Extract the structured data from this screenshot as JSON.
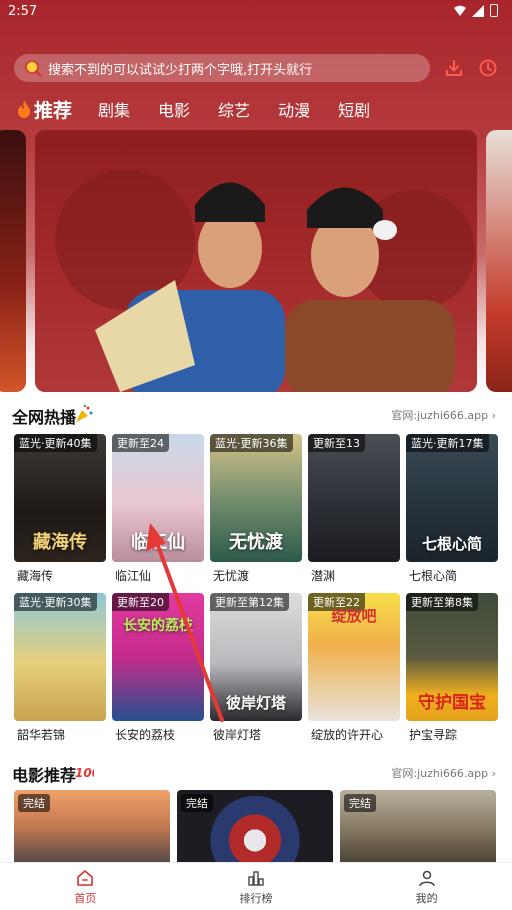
{
  "status": {
    "time": "2:57"
  },
  "search": {
    "placeholder": "搜索不到的可以试试少打两个字哦,打开头就行"
  },
  "tabs": [
    {
      "label": "推荐"
    },
    {
      "label": "剧集"
    },
    {
      "label": "电影"
    },
    {
      "label": "综艺"
    },
    {
      "label": "动漫"
    },
    {
      "label": "短剧"
    }
  ],
  "hot": {
    "title": "全网热播",
    "link": "官网:juzhi666.app",
    "items": [
      {
        "badge": "蓝光·更新40集",
        "title": "藏海传",
        "poster_title": "藏海传"
      },
      {
        "badge": "更新至24",
        "title": "临江仙",
        "poster_title": "临江仙"
      },
      {
        "badge": "蓝光·更新36集",
        "title": "无忧渡",
        "poster_title": "无忧渡"
      },
      {
        "badge": "更新至13",
        "title": "潜渊",
        "poster_title": ""
      },
      {
        "badge": "蓝光·更新17集",
        "title": "七根心简",
        "poster_title": "七根心简"
      },
      {
        "badge": "蓝光·更新30集",
        "title": "韶华若锦",
        "poster_title": ""
      },
      {
        "badge": "更新至20",
        "title": "长安的荔枝",
        "poster_title": "长安的荔枝"
      },
      {
        "badge": "更新至第12集",
        "title": "彼岸灯塔",
        "poster_title": "彼岸灯塔"
      },
      {
        "badge": "更新至22",
        "title": "绽放的许开心",
        "poster_title": "绽放吧"
      },
      {
        "badge": "更新至第8集",
        "title": "护宝寻踪",
        "poster_title": "守护国宝"
      }
    ]
  },
  "movies": {
    "title": "电影推荐",
    "link": "官网:juzhi666.app",
    "items": [
      {
        "badge": "完结"
      },
      {
        "badge": "完结"
      },
      {
        "badge": "完结"
      }
    ]
  },
  "nav": [
    {
      "label": "首页"
    },
    {
      "label": "排行榜"
    },
    {
      "label": "我的"
    }
  ],
  "colors": {
    "accent": "#d8332e",
    "header_bg": "#a8262b"
  }
}
